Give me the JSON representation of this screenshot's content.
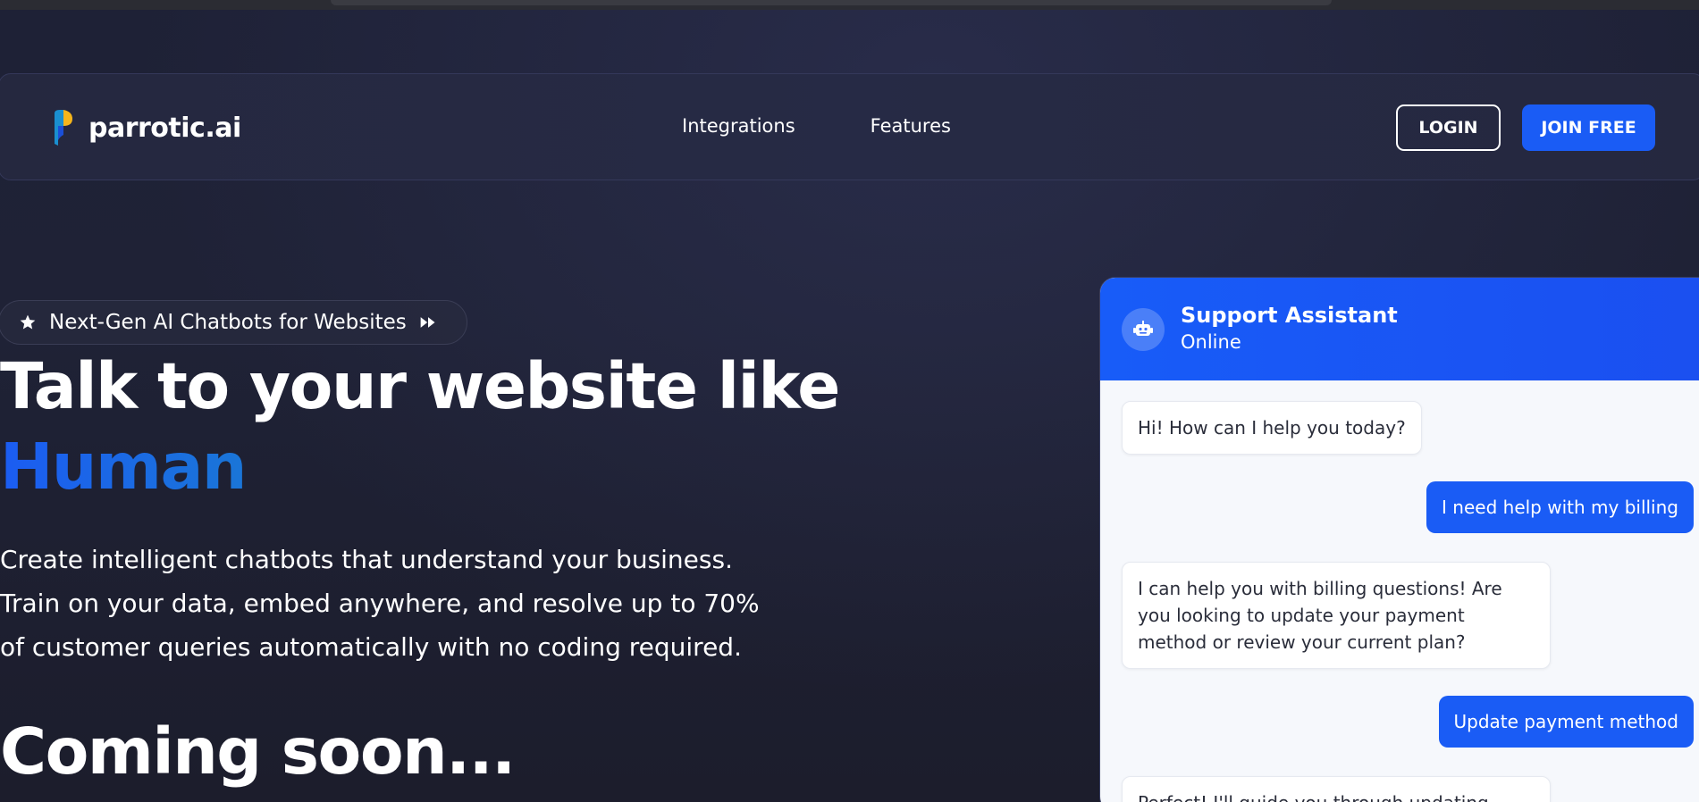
{
  "nav": {
    "brand": "parrotic.ai",
    "links": [
      "Integrations",
      "Features"
    ],
    "login": "LOGIN",
    "join": "JOIN FREE"
  },
  "hero": {
    "badge": "Next-Gen AI Chatbots for Websites",
    "title_line1": "Talk to your website like",
    "title_accent": "Human",
    "description_lines": [
      "Create intelligent chatbots that understand your business.",
      "Train on your data, embed anywhere, and resolve up to 70%",
      "of customer queries automatically with no coding required."
    ],
    "coming_soon": "Coming soon..."
  },
  "chat": {
    "title": "Support Assistant",
    "status": "Online",
    "messages": [
      {
        "from": "bot",
        "text": "Hi! How can I help you today?"
      },
      {
        "from": "user",
        "text": "I need help with my billing"
      },
      {
        "from": "bot",
        "text": "I can help you with billing questions! Are you looking to update your payment method or review your current plan?"
      },
      {
        "from": "user",
        "text": "Update payment method"
      },
      {
        "from": "bot",
        "text": "Perfect! I'll guide you through updating..."
      }
    ]
  },
  "colors": {
    "primary": "#1a5cf5",
    "background": "#1e2136",
    "accent_gradient": [
      "#1b5cf2",
      "#18a487"
    ]
  },
  "icons": {
    "brand": "parrot-logo-icon",
    "badge_left": "star-icon",
    "badge_right": "fast-forward-icon",
    "chat_avatar": "robot-icon"
  }
}
